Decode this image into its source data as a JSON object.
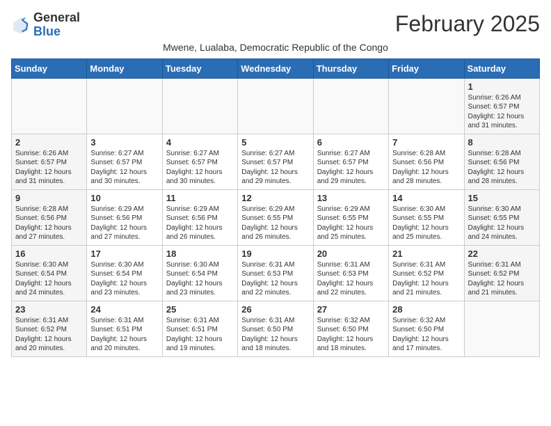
{
  "header": {
    "logo_general": "General",
    "logo_blue": "Blue",
    "month_title": "February 2025",
    "subtitle": "Mwene, Lualaba, Democratic Republic of the Congo"
  },
  "weekdays": [
    "Sunday",
    "Monday",
    "Tuesday",
    "Wednesday",
    "Thursday",
    "Friday",
    "Saturday"
  ],
  "weeks": [
    [
      {
        "day": "",
        "info": ""
      },
      {
        "day": "",
        "info": ""
      },
      {
        "day": "",
        "info": ""
      },
      {
        "day": "",
        "info": ""
      },
      {
        "day": "",
        "info": ""
      },
      {
        "day": "",
        "info": ""
      },
      {
        "day": "1",
        "info": "Sunrise: 6:26 AM\nSunset: 6:57 PM\nDaylight: 12 hours and 31 minutes."
      }
    ],
    [
      {
        "day": "2",
        "info": "Sunrise: 6:26 AM\nSunset: 6:57 PM\nDaylight: 12 hours and 31 minutes."
      },
      {
        "day": "3",
        "info": "Sunrise: 6:27 AM\nSunset: 6:57 PM\nDaylight: 12 hours and 30 minutes."
      },
      {
        "day": "4",
        "info": "Sunrise: 6:27 AM\nSunset: 6:57 PM\nDaylight: 12 hours and 30 minutes."
      },
      {
        "day": "5",
        "info": "Sunrise: 6:27 AM\nSunset: 6:57 PM\nDaylight: 12 hours and 29 minutes."
      },
      {
        "day": "6",
        "info": "Sunrise: 6:27 AM\nSunset: 6:57 PM\nDaylight: 12 hours and 29 minutes."
      },
      {
        "day": "7",
        "info": "Sunrise: 6:28 AM\nSunset: 6:56 PM\nDaylight: 12 hours and 28 minutes."
      },
      {
        "day": "8",
        "info": "Sunrise: 6:28 AM\nSunset: 6:56 PM\nDaylight: 12 hours and 28 minutes."
      }
    ],
    [
      {
        "day": "9",
        "info": "Sunrise: 6:28 AM\nSunset: 6:56 PM\nDaylight: 12 hours and 27 minutes."
      },
      {
        "day": "10",
        "info": "Sunrise: 6:29 AM\nSunset: 6:56 PM\nDaylight: 12 hours and 27 minutes."
      },
      {
        "day": "11",
        "info": "Sunrise: 6:29 AM\nSunset: 6:56 PM\nDaylight: 12 hours and 26 minutes."
      },
      {
        "day": "12",
        "info": "Sunrise: 6:29 AM\nSunset: 6:55 PM\nDaylight: 12 hours and 26 minutes."
      },
      {
        "day": "13",
        "info": "Sunrise: 6:29 AM\nSunset: 6:55 PM\nDaylight: 12 hours and 25 minutes."
      },
      {
        "day": "14",
        "info": "Sunrise: 6:30 AM\nSunset: 6:55 PM\nDaylight: 12 hours and 25 minutes."
      },
      {
        "day": "15",
        "info": "Sunrise: 6:30 AM\nSunset: 6:55 PM\nDaylight: 12 hours and 24 minutes."
      }
    ],
    [
      {
        "day": "16",
        "info": "Sunrise: 6:30 AM\nSunset: 6:54 PM\nDaylight: 12 hours and 24 minutes."
      },
      {
        "day": "17",
        "info": "Sunrise: 6:30 AM\nSunset: 6:54 PM\nDaylight: 12 hours and 23 minutes."
      },
      {
        "day": "18",
        "info": "Sunrise: 6:30 AM\nSunset: 6:54 PM\nDaylight: 12 hours and 23 minutes."
      },
      {
        "day": "19",
        "info": "Sunrise: 6:31 AM\nSunset: 6:53 PM\nDaylight: 12 hours and 22 minutes."
      },
      {
        "day": "20",
        "info": "Sunrise: 6:31 AM\nSunset: 6:53 PM\nDaylight: 12 hours and 22 minutes."
      },
      {
        "day": "21",
        "info": "Sunrise: 6:31 AM\nSunset: 6:52 PM\nDaylight: 12 hours and 21 minutes."
      },
      {
        "day": "22",
        "info": "Sunrise: 6:31 AM\nSunset: 6:52 PM\nDaylight: 12 hours and 21 minutes."
      }
    ],
    [
      {
        "day": "23",
        "info": "Sunrise: 6:31 AM\nSunset: 6:52 PM\nDaylight: 12 hours and 20 minutes."
      },
      {
        "day": "24",
        "info": "Sunrise: 6:31 AM\nSunset: 6:51 PM\nDaylight: 12 hours and 20 minutes."
      },
      {
        "day": "25",
        "info": "Sunrise: 6:31 AM\nSunset: 6:51 PM\nDaylight: 12 hours and 19 minutes."
      },
      {
        "day": "26",
        "info": "Sunrise: 6:31 AM\nSunset: 6:50 PM\nDaylight: 12 hours and 18 minutes."
      },
      {
        "day": "27",
        "info": "Sunrise: 6:32 AM\nSunset: 6:50 PM\nDaylight: 12 hours and 18 minutes."
      },
      {
        "day": "28",
        "info": "Sunrise: 6:32 AM\nSunset: 6:50 PM\nDaylight: 12 hours and 17 minutes."
      },
      {
        "day": "",
        "info": ""
      }
    ]
  ]
}
